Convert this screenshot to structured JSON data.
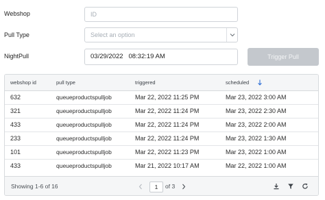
{
  "form": {
    "webshop_label": "Webshop",
    "webshop_placeholder": "ID",
    "pull_type_label": "Pull Type",
    "pull_type_placeholder": "Select an option",
    "nightpull_label": "NightPull",
    "nightpull_value": "03/29/2022   08:32:19 AM",
    "trigger_label": "Trigger Pull"
  },
  "table": {
    "columns": [
      "webshop id",
      "pull type",
      "triggered",
      "scheduled"
    ],
    "sorted_column": "scheduled",
    "sort_direction": "descending",
    "rows": [
      [
        "632",
        "queueproductspulljob",
        "Mar 22, 2022 11:25 PM",
        "Mar 23, 2022 3:00 AM"
      ],
      [
        "321",
        "queueproductspulljob",
        "Mar 22, 2022 11:24 PM",
        "Mar 23, 2022 2:30 AM"
      ],
      [
        "433",
        "queueproductspulljob",
        "Mar 22, 2022 11:24 PM",
        "Mar 23, 2022 2:00 AM"
      ],
      [
        "233",
        "queueproductspulljob",
        "Mar 22, 2022 11:24 PM",
        "Mar 23, 2022 1:30 AM"
      ],
      [
        "101",
        "queueproductspulljob",
        "Mar 22, 2022 11:23 PM",
        "Mar 23, 2022 1:00 AM"
      ],
      [
        "433",
        "queueproductspulljob",
        "Mar 21, 2022 10:17 AM",
        "Mar 22, 2022 1:00 AM"
      ]
    ]
  },
  "footer": {
    "showing": "Showing 1-6 of 16",
    "current_page": "1",
    "of_pages": "of 3"
  },
  "colors": {
    "accent": "#2f6fd6",
    "disabled_button": "#c4c8cd",
    "header_bg": "#f5f6f7",
    "border": "#d7dadd"
  },
  "icons": [
    "chevron-down-icon",
    "sort-descending-icon",
    "chevron-left-icon",
    "chevron-right-icon",
    "download-icon",
    "filter-icon",
    "refresh-icon"
  ]
}
